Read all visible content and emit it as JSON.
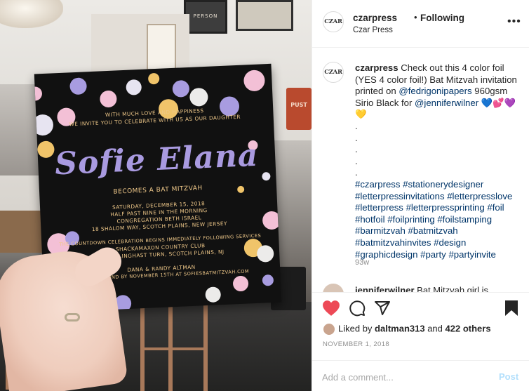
{
  "post_image": {
    "invitation": {
      "intro_lines": [
        "With much love and happiness",
        "we invite you to celebrate with us as our daughter"
      ],
      "name": "Sofie Elana",
      "subtitle": "BECOMES A BAT MITZVAH",
      "details": [
        "SATURDAY, DECEMBER 15, 2018",
        "HALF PAST NINE IN THE MORNING",
        "CONGREGATION BETH ISRAEL",
        "18 SHALOM WAY, SCOTCH PLAINS, NEW JERSEY",
        "THE COUNTDOWN CELEBRATION BEGINS IMMEDIATELY FOLLOWING SERVICES",
        "SHACKAMAXON COUNTRY CLUB",
        "100 TILLINGHAST TURN, SCOTCH PLAINS, NJ",
        "DANA & RANDY ALTMAN",
        "KINDLY RESPOND BY NOVEMBER 15TH AT SOFIESBATMITZVAH.COM"
      ]
    },
    "wall_sign": "PERSON",
    "can_label": "PUST"
  },
  "header": {
    "avatar_text": "CZAR",
    "username": "czarpress",
    "separator": "•",
    "follow_status": "Following",
    "subtitle": "Czar Press",
    "more_icon": "more-horizontal-icon"
  },
  "caption": {
    "avatar_text": "CZAR",
    "username": "czarpress",
    "text_before": " Check out this 4 color foil (YES 4 color foil!) Bat Mitzvah invitation printed on ",
    "mention1": "@fedrigonipapers",
    "text_middle": " 960gsm Sirio Black for ",
    "mention2": "@jenniferwilner",
    "hearts": " 💙💕💜💛",
    "dots": [
      ".",
      ".",
      ".",
      ".",
      "."
    ],
    "hashtags": [
      "#czarpress",
      "#stationerydesigner",
      "#letterpressinvitations",
      "#letterpresslove",
      "#letterpress",
      "#letterpressprinting",
      "#foil",
      "#hotfoil",
      "#foilprinting",
      "#foilstamping",
      "#barmitzvah",
      "#batmitzvah",
      "#batmitzvahinvites",
      "#design",
      "#graphicdesign",
      "#party",
      "#partyinvite"
    ],
    "age": "93w",
    "next_comment_user": "jenniferwilner",
    "next_comment_text": "Bat Mitzvah girl is"
  },
  "actions": {
    "liked_by_prefix": "Liked by ",
    "liked_by_user": "daltman313",
    "liked_by_and": " and ",
    "liked_by_count": "422 others",
    "date": "NOVEMBER 1, 2018",
    "comment_placeholder": "Add a comment...",
    "post_label": "Post",
    "heart_color": "#ed4956"
  }
}
